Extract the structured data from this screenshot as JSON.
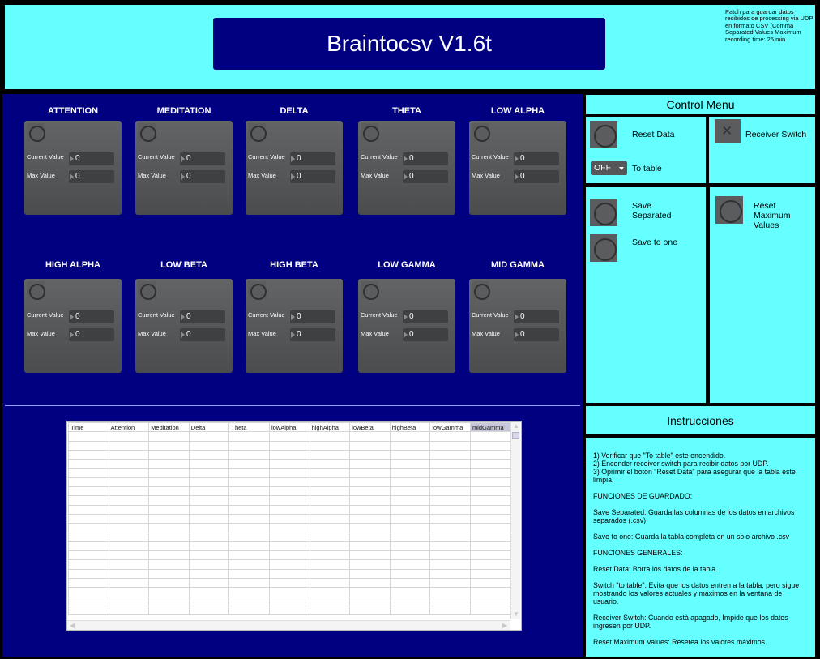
{
  "header": {
    "title": "Braintocsv V1.6t",
    "note": "Patch para guardar datos recibidos de processing via UDP en formato CSV (Comma Separated Values Maximum recording time: 25 min"
  },
  "channels": [
    {
      "name": "ATTENTION",
      "current_label": "Current Value",
      "max_label": "Max Value",
      "current": "0",
      "max": "0"
    },
    {
      "name": "MEDITATION",
      "current_label": "Current Value",
      "max_label": "Max Value",
      "current": "0",
      "max": "0"
    },
    {
      "name": "DELTA",
      "current_label": "Current Value",
      "max_label": "Max Value",
      "current": "0",
      "max": "0"
    },
    {
      "name": "THETA",
      "current_label": "Current Value",
      "max_label": "Max Value",
      "current": "0",
      "max": "0"
    },
    {
      "name": "LOW ALPHA",
      "current_label": "Current Value",
      "max_label": "Max Value",
      "current": "0",
      "max": "0"
    },
    {
      "name": "HIGH ALPHA",
      "current_label": "Current Value",
      "max_label": "Max Value",
      "current": "0",
      "max": "0"
    },
    {
      "name": "LOW BETA",
      "current_label": "Current Value",
      "max_label": "Max Value",
      "current": "0",
      "max": "0"
    },
    {
      "name": "HIGH BETA",
      "current_label": "Current Value",
      "max_label": "Max Value",
      "current": "0",
      "max": "0"
    },
    {
      "name": "LOW GAMMA",
      "current_label": "Current Value",
      "max_label": "Max Value",
      "current": "0",
      "max": "0"
    },
    {
      "name": "MID GAMMA",
      "current_label": "Current Value",
      "max_label": "Max Value",
      "current": "0",
      "max": "0"
    }
  ],
  "table": {
    "columns": [
      "Time",
      "Attention",
      "Meditation",
      "Delta",
      "Theta",
      "lowAlpha",
      "highAlpha",
      "lowBeta",
      "highBeta",
      "lowGamma",
      "midGamma"
    ],
    "selected_column": "midGamma",
    "scroll_arrows": {
      "up": "▲",
      "down": "▼",
      "left": "◀",
      "right": "▶"
    }
  },
  "control_menu": {
    "title": "Control Menu",
    "reset_data": "Reset Data",
    "receiver_switch": "Receiver Switch",
    "receiver_switch_icon": "✕",
    "to_table_value": "OFF",
    "to_table_label": "To table",
    "save_separated": "Save\nSeparated",
    "save_to_one": "Save to one",
    "reset_max": "Reset\nMaximum\nValues"
  },
  "instructions": {
    "title": "Instrucciones",
    "text": "1) Verificar que \"To table\" este encendido.\n2) Encender receiver switch para recibir datos por UDP.\n3) Oprimir el boton \"Reset Data\" para asegurar que la tabla este limpia.\n\nFUNCIONES DE GUARDADO:\n\nSave Separated: Guarda las columnas de los datos en archivos separados (.csv)\n\nSave to one: Guarda la tabla completa en un solo archivo .csv\n\nFUNCIONES GENERALES:\n\nReset Data: Borra los datos de la tabla.\n\nSwitch \"to table\": Evita que los datos entren a la tabla, pero sigue mostrando los valores actuales y máximos en la ventana de usuario.\n\nReceiver Switch: Cuando està apagado, Impide que los datos ingresen por UDP.\n\nReset Maximum Values: Resetea los valores máximos."
  }
}
